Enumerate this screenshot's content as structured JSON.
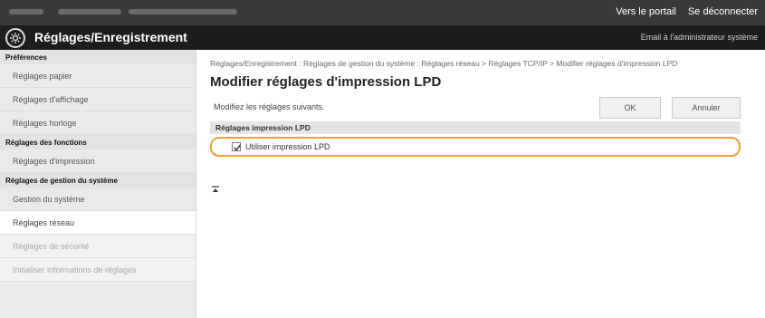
{
  "topbar": {
    "link_portal": "Vers le portail",
    "link_logout": "Se déconnecter"
  },
  "header": {
    "title": "Réglages/Enregistrement",
    "admin_email": "Email à l'administrateur système",
    "logo_icon": "gear-icon"
  },
  "sidebar": {
    "sections": [
      {
        "title": "Préférences",
        "items": [
          "Réglages papier",
          "Réglages d'affichage",
          "Réglages horloge"
        ]
      },
      {
        "title": "Réglages des fonctions",
        "items": [
          "Réglages d'impression"
        ]
      },
      {
        "title": "Réglages de gestion du système",
        "items": [
          "Gestion du système",
          "Réglages réseau",
          "Réglages de sécurité",
          "Initialiser informations de réglages"
        ]
      }
    ],
    "active_item": "Réglages réseau"
  },
  "main": {
    "breadcrumb": "Réglages/Enregistrement : Réglages de gestion du système : Réglages réseau > Réglages TCP/IP > Modifier réglages d'impression LPD",
    "title": "Modifier réglages d'impression LPD",
    "instruction": "Modifiez les réglages suivants.",
    "ok_label": "OK",
    "cancel_label": "Annuler",
    "section_title": "Réglages impression LPD",
    "option_label": "Utiliser impression LPD",
    "option_checked": true,
    "collapse_icon": "collapse-icon"
  },
  "colors": {
    "highlight": "#f0a030",
    "header_bg": "#1d1d1d",
    "sidebar_bg": "#eaeaea"
  }
}
